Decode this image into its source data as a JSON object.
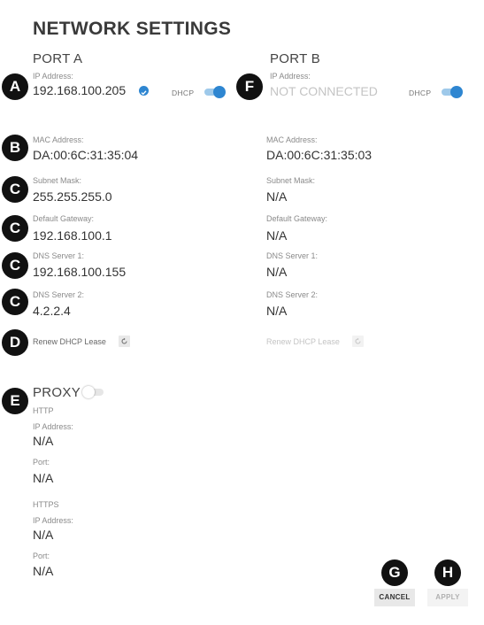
{
  "title": "NETWORK SETTINGS",
  "port_a": {
    "heading": "PORT A",
    "ip_label": "IP Address:",
    "ip_value": "192.168.100.205",
    "dhcp_label": "DHCP",
    "dhcp_on": true,
    "mac_label": "MAC Address:",
    "mac_value": "DA:00:6C:31:35:04",
    "subnet_label": "Subnet Mask:",
    "subnet_value": "255.255.255.0",
    "gateway_label": "Default Gateway:",
    "gateway_value": "192.168.100.1",
    "dns1_label": "DNS Server 1:",
    "dns1_value": "192.168.100.155",
    "dns2_label": "DNS Server 2:",
    "dns2_value": "4.2.2.4",
    "renew_label": "Renew DHCP Lease"
  },
  "port_b": {
    "heading": "PORT B",
    "ip_label": "IP Address:",
    "ip_value": "NOT CONNECTED",
    "dhcp_label": "DHCP",
    "dhcp_on": true,
    "mac_label": "MAC Address:",
    "mac_value": "DA:00:6C:31:35:03",
    "subnet_label": "Subnet Mask:",
    "subnet_value": "N/A",
    "gateway_label": "Default Gateway:",
    "gateway_value": "N/A",
    "dns1_label": "DNS Server 1:",
    "dns1_value": "N/A",
    "dns2_label": "DNS Server 2:",
    "dns2_value": "N/A",
    "renew_label": "Renew DHCP Lease"
  },
  "proxy": {
    "heading": "PROXY",
    "enabled": false,
    "http": {
      "heading": "HTTP",
      "ip_label": "IP Address:",
      "ip_value": "N/A",
      "port_label": "Port:",
      "port_value": "N/A"
    },
    "https": {
      "heading": "HTTPS",
      "ip_label": "IP Address:",
      "ip_value": "N/A",
      "port_label": "Port:",
      "port_value": "N/A"
    }
  },
  "markers": {
    "a": "A",
    "b": "B",
    "c1": "C",
    "c2": "C",
    "c3": "C",
    "c4": "C",
    "d": "D",
    "e": "E",
    "f": "F",
    "g": "G",
    "h": "H"
  },
  "buttons": {
    "cancel": "CANCEL",
    "apply": "APPLY"
  },
  "colors": {
    "accent": "#2e86d1",
    "marker": "#111111"
  }
}
